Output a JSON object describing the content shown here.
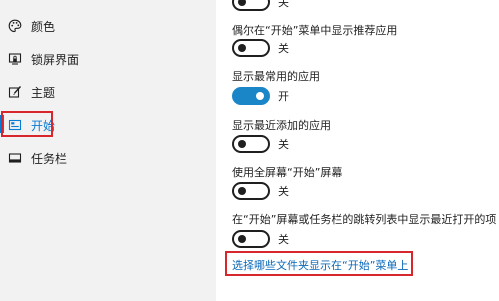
{
  "sidebar": {
    "items": [
      {
        "label": "颜色",
        "icon": "palette-icon"
      },
      {
        "label": "锁屏界面",
        "icon": "lock-screen-icon"
      },
      {
        "label": "主题",
        "icon": "theme-brush-icon"
      },
      {
        "label": "开始",
        "icon": "start-menu-icon",
        "active": true
      },
      {
        "label": "任务栏",
        "icon": "taskbar-icon"
      }
    ]
  },
  "main": {
    "settings": [
      {
        "label": "",
        "state_text": "关",
        "on": false
      },
      {
        "label": "偶尔在“开始”菜单中显示推荐应用",
        "state_text": "关",
        "on": false
      },
      {
        "label": "显示最常用的应用",
        "state_text": "开",
        "on": true
      },
      {
        "label": "显示最近添加的应用",
        "state_text": "关",
        "on": false
      },
      {
        "label": "使用全屏幕“开始”屏幕",
        "state_text": "关",
        "on": false
      },
      {
        "label": "在“开始”屏幕或任务栏的跳转列表中显示最近打开的项",
        "state_text": "关",
        "on": false
      }
    ],
    "link": "选择哪些文件夹显示在“开始”菜单上"
  },
  "colors": {
    "accent": "#0a7bd3",
    "toggle_on": "#1a86c8",
    "highlight": "#d7262c",
    "sidebar_bg": "#f2f2f2"
  }
}
